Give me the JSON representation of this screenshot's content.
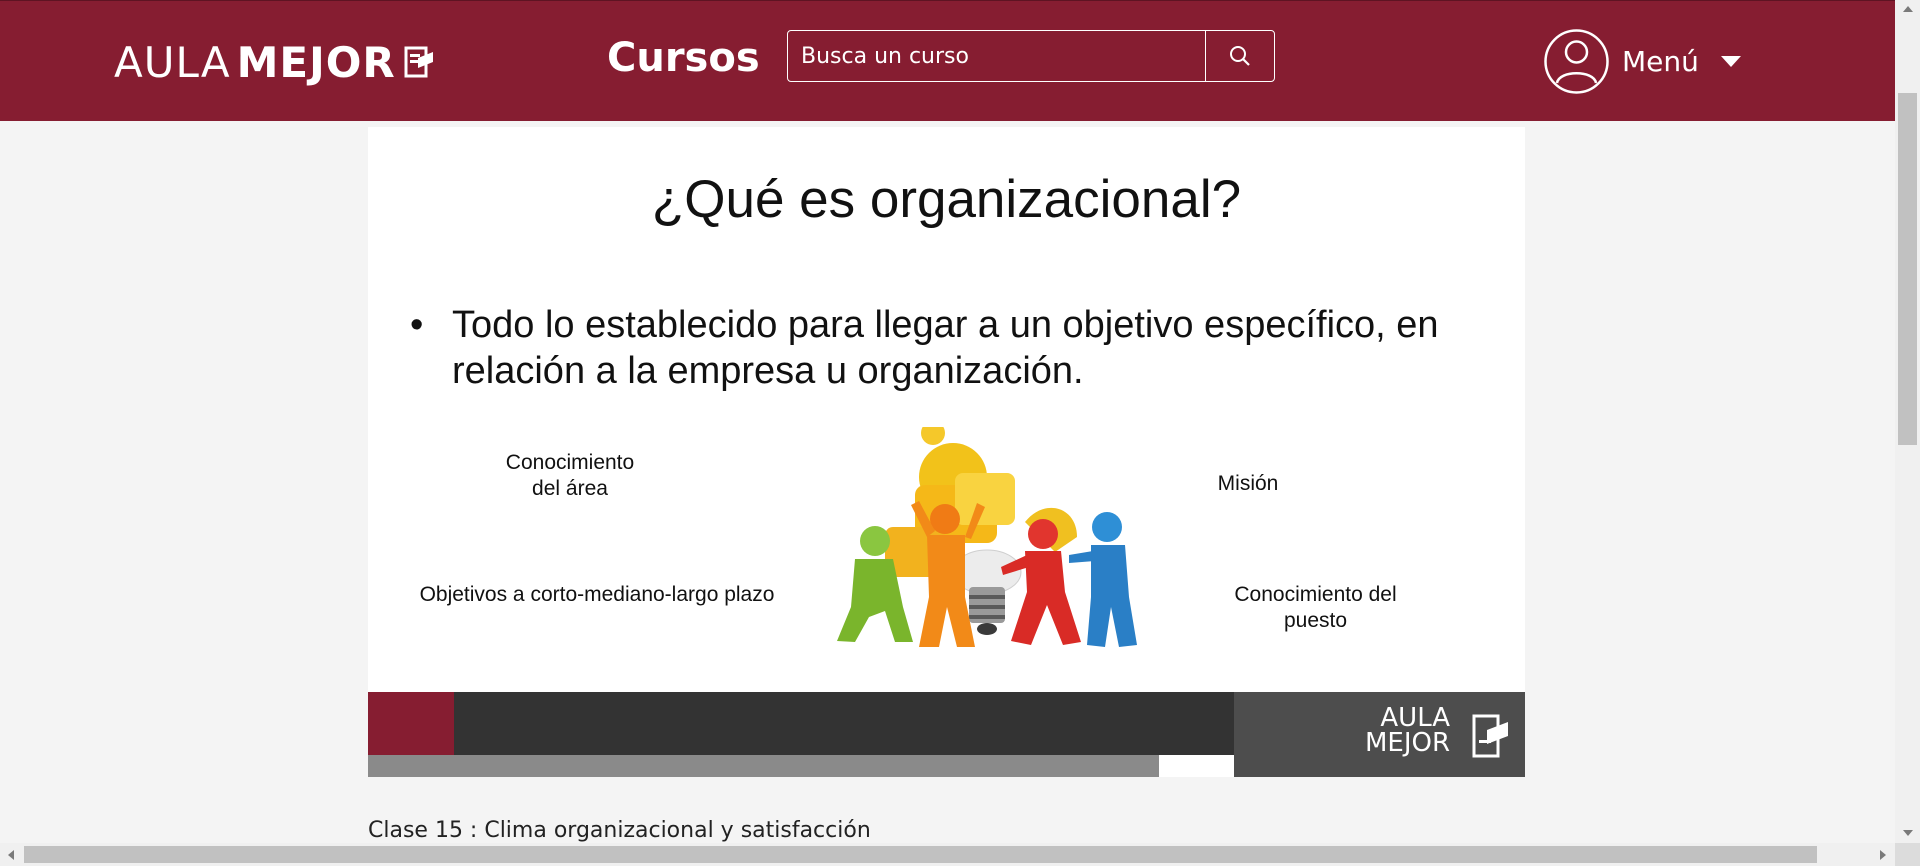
{
  "header": {
    "logo_light": "AULA",
    "logo_bold": "MEJOR",
    "nav_courses": "Cursos",
    "search_placeholder": "Busca un curso",
    "menu_label": "Menú"
  },
  "slide": {
    "title": "¿Qué es organizacional?",
    "bullet_symbol": "•",
    "bullet_text": "Todo lo establecido para llegar a un objetivo específico, en relación a la empresa u organización.",
    "labels": {
      "area_line1": "Conocimiento",
      "area_line2": "del área",
      "mision": "Misión",
      "objetivos": "Objetivos a corto-mediano-largo plazo",
      "puesto_line1": "Conocimiento del",
      "puesto_line2": "puesto"
    },
    "footer_logo_line1": "AULA",
    "footer_logo_line2": "MEJOR"
  },
  "caption": "Clase 15 : Clima organizacional y satisfacción",
  "icons": {
    "search": "search-icon",
    "user": "user-circle-icon",
    "caret": "caret-down-icon",
    "logo_badge": "graduation-book-icon"
  },
  "colors": {
    "brand": "#861d31",
    "footer_dark": "#333333",
    "footer_mid": "#4d4d4d",
    "footer_gray": "#8a8a8a"
  }
}
